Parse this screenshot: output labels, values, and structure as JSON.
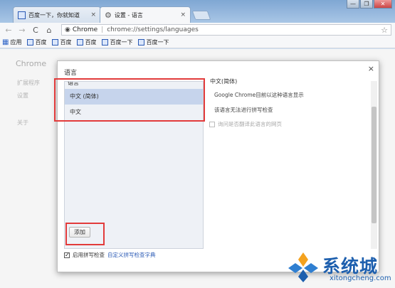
{
  "tabs": [
    {
      "title": "百度一下，你就知道",
      "close": "×"
    },
    {
      "title": "设置 - 语言",
      "close": "×"
    }
  ],
  "window_buttons": [
    "—",
    "❐",
    "✕"
  ],
  "toolbar": {
    "back": "←",
    "forward": "→",
    "reload": "C",
    "home": "⌂",
    "omnibox": {
      "label": "Chrome",
      "separator": "|",
      "url": "chrome://settings/languages",
      "star": "☆"
    }
  },
  "bookmarks": {
    "apps_label": "应用",
    "items": [
      "百度",
      "百度",
      "百度",
      "百度一下",
      "百度一下"
    ]
  },
  "page_background": {
    "brand": "Chrome",
    "nav": [
      "扩展程序",
      "设置",
      "关于"
    ]
  },
  "dialog": {
    "title": "语言",
    "close": "×",
    "list_header": "语言",
    "languages": [
      "中文 (简体)",
      "中文"
    ],
    "selected_index": 0,
    "right_header": "中文(简体)",
    "info_lines": [
      "Google Chrome目前以这种语言显示",
      "该语言无法进行拼写检查"
    ],
    "translate_option": "询问是否翻译此语言的网页",
    "add_button": "添加",
    "spellcheck": {
      "label": "启用拼写检查",
      "link": "自定义拼写检查字典",
      "checked": true
    }
  },
  "watermark": {
    "big": "系统城",
    "small": "xitongcheng.com"
  },
  "colors": {
    "highlight": "#e23b3b",
    "selected_row": "#c6d4ec",
    "link": "#2a5ab5",
    "watermark": "#1d5fae"
  }
}
